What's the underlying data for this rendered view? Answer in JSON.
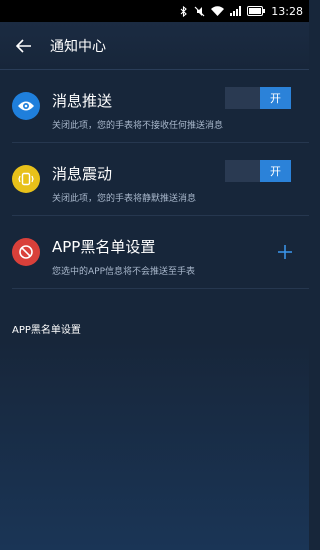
{
  "status_bar": {
    "time": "13:28"
  },
  "header": {
    "title": "通知中心"
  },
  "settings": [
    {
      "title": "消息推送",
      "description": "关闭此项，您的手表将不接收任何推送消息",
      "toggle_label": "开",
      "icon": "eye-icon",
      "icon_color": "#1f7fdc"
    },
    {
      "title": "消息震动",
      "description": "关闭此项，您的手表将静默推送消息",
      "toggle_label": "开",
      "icon": "vibrate-icon",
      "icon_color": "#e8c11a"
    },
    {
      "title": "APP黑名单设置",
      "description": "您选中的APP信息将不会推送至手表",
      "icon": "block-icon",
      "icon_color": "#d9403a"
    }
  ],
  "blacklist_section": {
    "header": "APP黑名单设置"
  },
  "colors": {
    "background": "#17263a",
    "accent": "#2b82d9"
  }
}
